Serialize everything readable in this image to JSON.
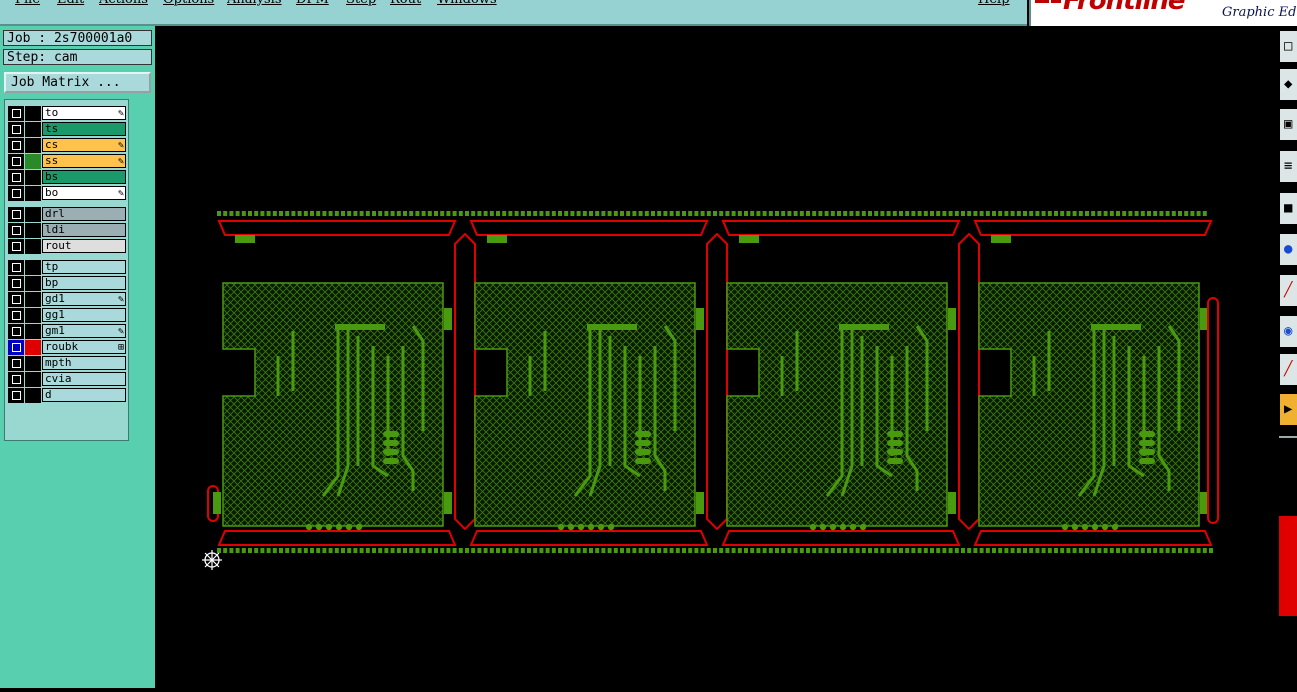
{
  "menubar": {
    "items": [
      "File",
      "Edit",
      "Actions",
      "Options",
      "Analysis",
      "DFM",
      "Step",
      "Rout",
      "Windows"
    ],
    "help": "Help"
  },
  "brand": {
    "logo": "Frontline",
    "subtitle": "Graphic Edit",
    "accent_color": "#c00000"
  },
  "job": {
    "job_label": "Job : 2s700001a0",
    "step_label": "Step: cam",
    "matrix_button": "Job Matrix ..."
  },
  "layers": [
    {
      "name": "to",
      "bg": "#ffffff",
      "swatch": "#000000",
      "mark": "edit-icon"
    },
    {
      "name": "ts",
      "bg": "#1a9a6a",
      "swatch": "#000000",
      "mark": ""
    },
    {
      "name": "cs",
      "bg": "#ffc34d",
      "swatch": "#000000",
      "mark": "edit-icon"
    },
    {
      "name": "ss",
      "bg": "#ffc34d",
      "swatch": "#2a8a2a",
      "mark": "edit-icon"
    },
    {
      "name": "bs",
      "bg": "#1a9a6a",
      "swatch": "#000000",
      "mark": ""
    },
    {
      "name": "bo",
      "bg": "#ffffff",
      "swatch": "#000000",
      "mark": "edit-icon"
    },
    {
      "name": "drl",
      "bg": "#9aaeb4",
      "swatch": "#000000",
      "mark": ""
    },
    {
      "name": "ldi",
      "bg": "#9aaeb4",
      "swatch": "#000000",
      "mark": ""
    },
    {
      "name": "rout",
      "bg": "#dedede",
      "swatch": "#000000",
      "mark": ""
    },
    {
      "name": "tp",
      "bg": "#a9d9da",
      "swatch": "#000000",
      "mark": ""
    },
    {
      "name": "bp",
      "bg": "#a9d9da",
      "swatch": "#000000",
      "mark": ""
    },
    {
      "name": "gd1",
      "bg": "#a9d9da",
      "swatch": "#000000",
      "mark": "edit-icon"
    },
    {
      "name": "gg1",
      "bg": "#a9d9da",
      "swatch": "#000000",
      "mark": ""
    },
    {
      "name": "gm1",
      "bg": "#a9d9da",
      "swatch": "#000000",
      "mark": "edit-icon"
    },
    {
      "name": "roubk",
      "bg": "#a9d9da",
      "swatch": "#e00000",
      "mark": "grid-icon",
      "active": true
    },
    {
      "name": "mpth",
      "bg": "#a9d9da",
      "swatch": "#000000",
      "mark": ""
    },
    {
      "name": "cvia",
      "bg": "#a9d9da",
      "swatch": "#000000",
      "mark": ""
    },
    {
      "name": "d",
      "bg": "#a9d9da",
      "swatch": "#000000",
      "mark": ""
    }
  ],
  "board": {
    "panel_count": 4,
    "copper_color": "#4a9a10",
    "outline_color": "#e00000",
    "background": "#000000",
    "origin_icon": "crosshair-origin-icon"
  },
  "toolbar_right": [
    "layers-popup-icon",
    "snap-icon",
    "zoom-window-icon",
    "filter-icon",
    "fit-icon",
    "measure-icon",
    "draw-line-icon",
    "select-icon",
    "ruler-icon",
    "highlight-icon"
  ]
}
